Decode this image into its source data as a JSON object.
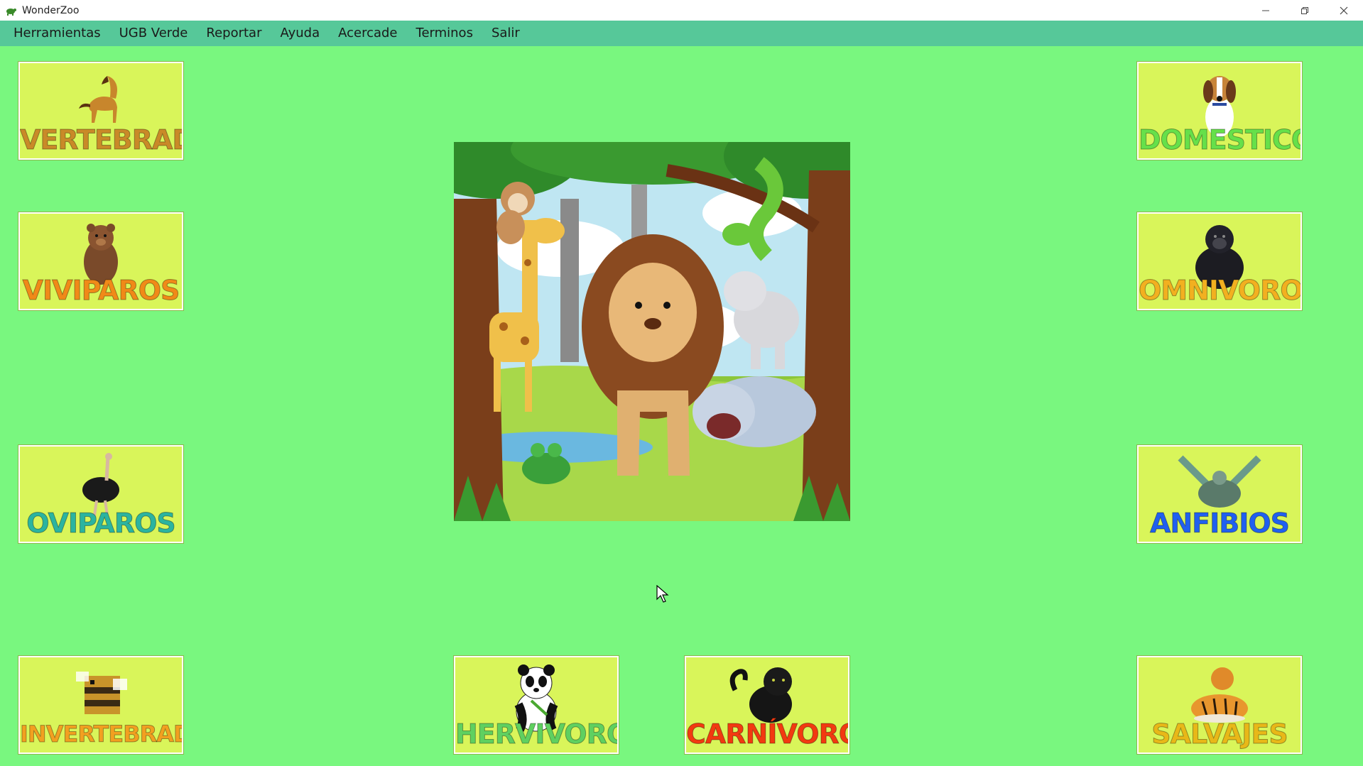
{
  "window": {
    "title": "WonderZoo"
  },
  "menu": {
    "items": [
      "Herramientas",
      "UGB Verde",
      "Reportar",
      "Ayuda",
      "Acercade",
      "Terminos",
      "Salir"
    ]
  },
  "tiles": {
    "vertebrados": {
      "label": "VERTEBRADOS",
      "icon": "horse-icon",
      "color": "#c98a28"
    },
    "viviparos": {
      "label": "VIVIPAROS",
      "icon": "bear-icon",
      "color": "#f08a18"
    },
    "oviparos": {
      "label": "OVIPAROS",
      "icon": "ostrich-icon",
      "color": "#2bb4a0"
    },
    "invertebrados": {
      "label": "INVERTEBRADOS",
      "icon": "bee-icon",
      "color": "#f2a020"
    },
    "herviboros": {
      "label": "HERVIVOROS",
      "icon": "panda-icon",
      "color": "#5fd060"
    },
    "carnivoros": {
      "label": "CARNÍVOROS",
      "icon": "panther-icon",
      "color": "#f23a10"
    },
    "domesticos": {
      "label": "DOMESTICOS",
      "icon": "dog-icon",
      "color": "#66e04a"
    },
    "omnivoros": {
      "label": "OMNIVOROS",
      "icon": "gorilla-icon",
      "color": "#f2b020"
    },
    "anfibios": {
      "label": "ANFIBIOS",
      "icon": "turtle-icon",
      "color": "#2060f0"
    },
    "salvajes": {
      "label": "SALVAJES",
      "icon": "tiger-icon",
      "color": "#e8b818"
    }
  },
  "main_image": {
    "icon": "jungle-animals-illustration"
  },
  "colors": {
    "background": "#79f77f",
    "menubar": "#56c899",
    "tile": "#d9f55a"
  }
}
